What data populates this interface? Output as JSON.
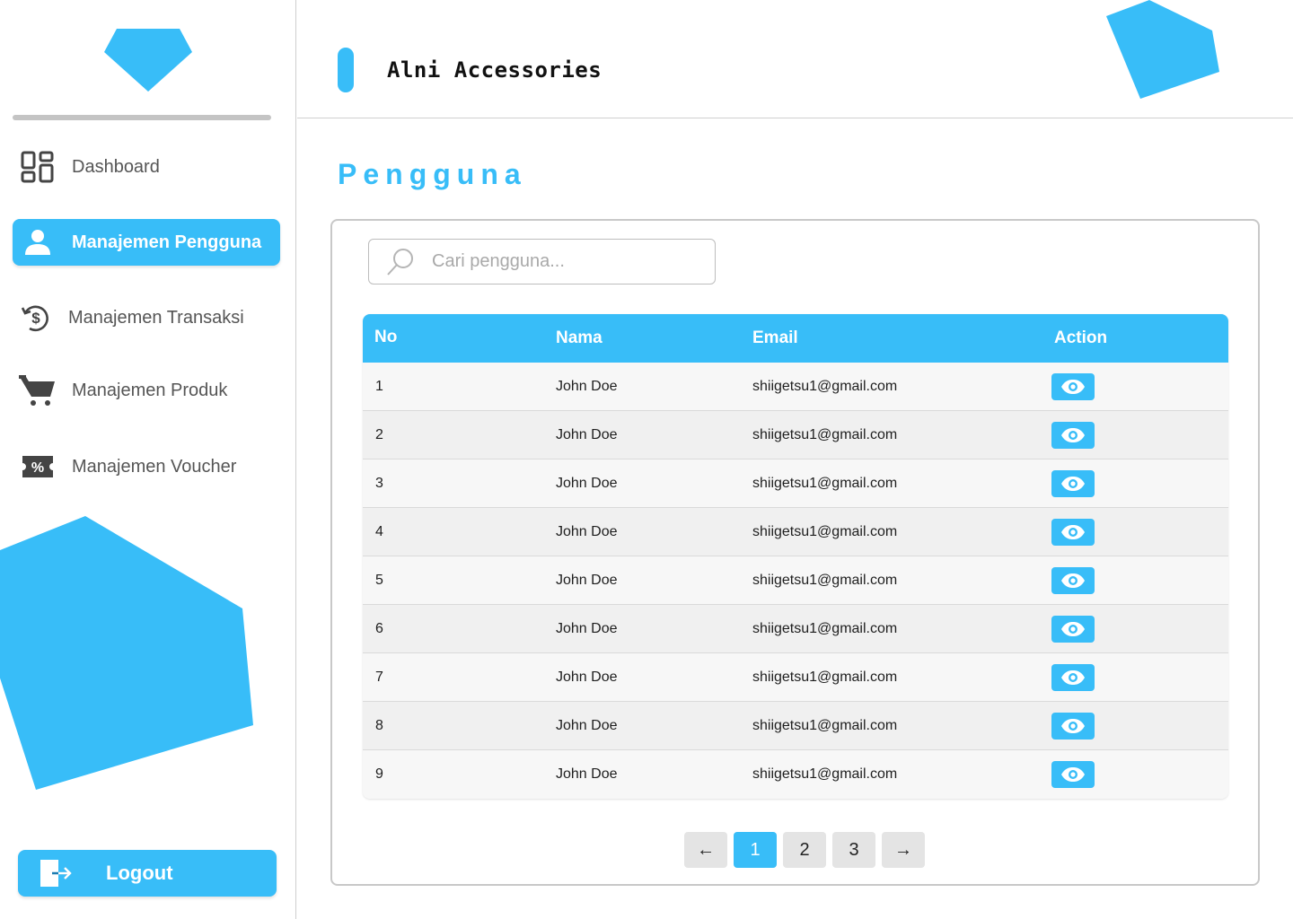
{
  "app": {
    "title": "Alni Accessories",
    "brand_color": "#38bdf8"
  },
  "sidebar": {
    "items": [
      {
        "label": "Dashboard",
        "icon": "dashboard-grid-icon",
        "active": false
      },
      {
        "label": "Manajemen Pengguna",
        "icon": "user-icon",
        "active": true
      },
      {
        "label": "Manajemen Transaksi",
        "icon": "transaction-dollar-icon",
        "active": false
      },
      {
        "label": "Manajemen Produk",
        "icon": "cart-icon",
        "active": false
      },
      {
        "label": "Manajemen Voucher",
        "icon": "voucher-percent-icon",
        "active": false
      }
    ],
    "logout_label": "Logout"
  },
  "page": {
    "title": "Pengguna"
  },
  "search": {
    "placeholder": "Cari pengguna...",
    "value": ""
  },
  "table": {
    "columns": [
      "No",
      "Nama",
      "Email",
      "Action"
    ],
    "rows": [
      {
        "no": "1",
        "nama": "John Doe",
        "email": "shiigetsu1@gmail.com"
      },
      {
        "no": "2",
        "nama": "John Doe",
        "email": "shiigetsu1@gmail.com"
      },
      {
        "no": "3",
        "nama": "John Doe",
        "email": "shiigetsu1@gmail.com"
      },
      {
        "no": "4",
        "nama": "John Doe",
        "email": "shiigetsu1@gmail.com"
      },
      {
        "no": "5",
        "nama": "John Doe",
        "email": "shiigetsu1@gmail.com"
      },
      {
        "no": "6",
        "nama": "John Doe",
        "email": "shiigetsu1@gmail.com"
      },
      {
        "no": "7",
        "nama": "John Doe",
        "email": "shiigetsu1@gmail.com"
      },
      {
        "no": "8",
        "nama": "John Doe",
        "email": "shiigetsu1@gmail.com"
      },
      {
        "no": "9",
        "nama": "John Doe",
        "email": "shiigetsu1@gmail.com"
      }
    ]
  },
  "pagination": {
    "prev": "←",
    "pages": [
      "1",
      "2",
      "3"
    ],
    "current": "1",
    "next": "→"
  }
}
